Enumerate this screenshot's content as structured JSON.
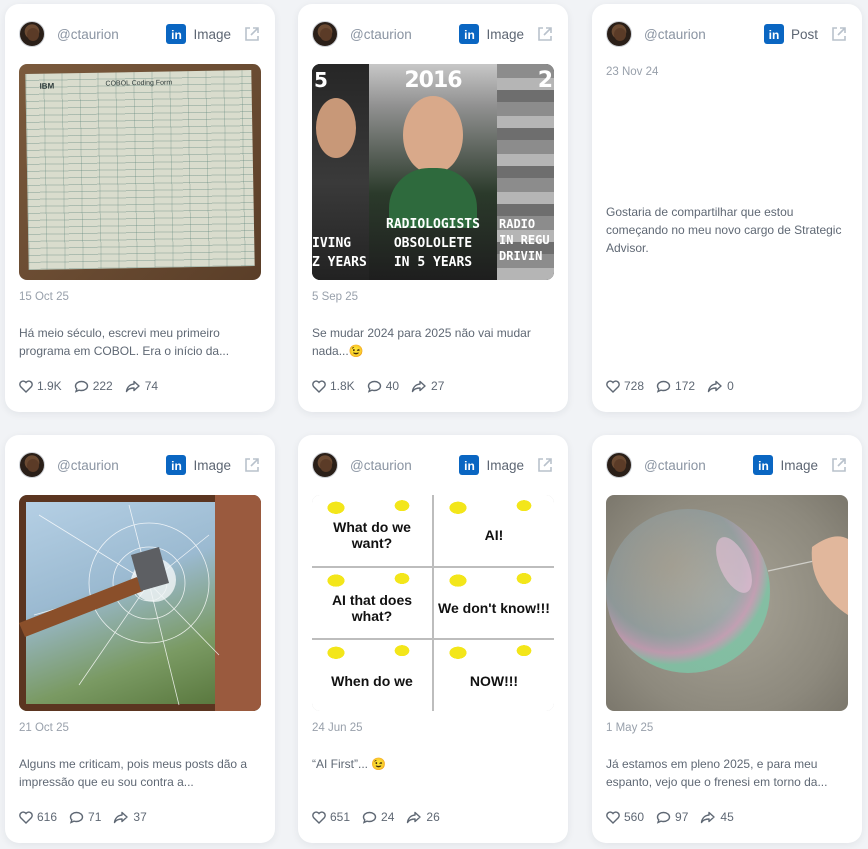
{
  "handle": "@ctaurion",
  "colors": {
    "linkedin": "#0a66c2",
    "card": "#ffffff",
    "background": "#f1f3f6"
  },
  "posts": [
    {
      "type": "Image",
      "date": "15 Oct 25",
      "text": "Há meio século, escrevi meu primeiro programa em COBOL. Era o início da...",
      "likes": "1.9K",
      "comments": "222",
      "shares": "74",
      "image": {
        "subject": "ibm-coding-form",
        "words": [
          "IBM",
          "COBOL Coding Form"
        ]
      }
    },
    {
      "type": "Image",
      "date": "5 Sep 25",
      "text": "Se mudar 2024 para 2025 não vai mudar nada...😉",
      "likes": "1.8K",
      "comments": "40",
      "shares": "27",
      "image": {
        "subject": "meme-predictions",
        "words": [
          "5",
          "IVING",
          "Z YEARS",
          "2016",
          "RADIOLOGISTS",
          "OBSOLOLETE",
          "IN 5 YEARS",
          "2",
          "RADIO",
          "IN REGU",
          "DRIVIN"
        ]
      }
    },
    {
      "type": "Post",
      "date": "23 Nov 24",
      "text": "Gostaria de compartilhar que estou começando no meu novo cargo de Strategic Advisor.",
      "likes": "728",
      "comments": "172",
      "shares": "0"
    },
    {
      "type": "Image",
      "date": "21 Oct 25",
      "text": "Alguns me criticam, pois meus posts dão a impressão que eu sou contra a...",
      "likes": "616",
      "comments": "71",
      "shares": "37",
      "image": {
        "subject": "hammer-breaking-window"
      }
    },
    {
      "type": "Image",
      "date": "24 Jun 25",
      "text": "“AI First”... 😉",
      "likes": "651",
      "comments": "24",
      "shares": "26",
      "image": {
        "subject": "meme-ai",
        "words": [
          "What do we want?",
          "AI!",
          "AI that does what?",
          "We don't know!!!",
          "When do we",
          "NOW!!!"
        ]
      }
    },
    {
      "type": "Image",
      "date": "1 May 25",
      "text": "Já estamos em pleno 2025, e para meu espanto, vejo que o frenesi em torno da...",
      "likes": "560",
      "comments": "97",
      "shares": "45",
      "image": {
        "subject": "soap-bubble-and-pin"
      }
    }
  ],
  "icons": {
    "platform": "linkedin-icon",
    "open": "external-link-icon",
    "like": "heart-icon",
    "comment": "comment-icon",
    "share": "share-icon"
  }
}
